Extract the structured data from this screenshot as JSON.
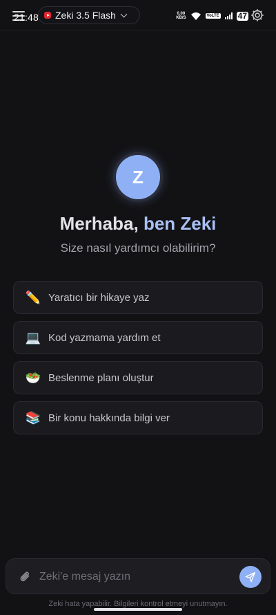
{
  "status": {
    "time": "21:48",
    "net_speed_value": "0,00",
    "net_speed_unit": "KB/S",
    "volte": "VoLTE",
    "battery": "47"
  },
  "header": {
    "model_name": "Zeki 3.5 Flash"
  },
  "hero": {
    "avatar_letter": "Z",
    "greeting_part1": "Merhaba, ",
    "greeting_part2": "ben Zeki",
    "subtitle": "Size nasıl yardımcı olabilirim?"
  },
  "suggestions": [
    {
      "icon": "✏️",
      "icon_name": "pencil-icon",
      "label": "Yaratıcı bir hikaye yaz"
    },
    {
      "icon": "💻",
      "icon_name": "laptop-icon",
      "label": "Kod yazmama yardım et"
    },
    {
      "icon": "🥗",
      "icon_name": "salad-icon",
      "label": "Beslenme planı oluştur"
    },
    {
      "icon": "📚",
      "icon_name": "books-icon",
      "label": "Bir konu hakkında bilgi ver"
    }
  ],
  "composer": {
    "placeholder": "Zeki'e mesaj yazın",
    "value": ""
  },
  "disclaimer": "Zeki hata yapabilir. Bilgileri kontrol etmeyi unutmayın.",
  "colors": {
    "background": "#121214",
    "accent": "#8fb0f5",
    "card": "#1b1b1f",
    "muted_text": "#a4a4ac"
  }
}
